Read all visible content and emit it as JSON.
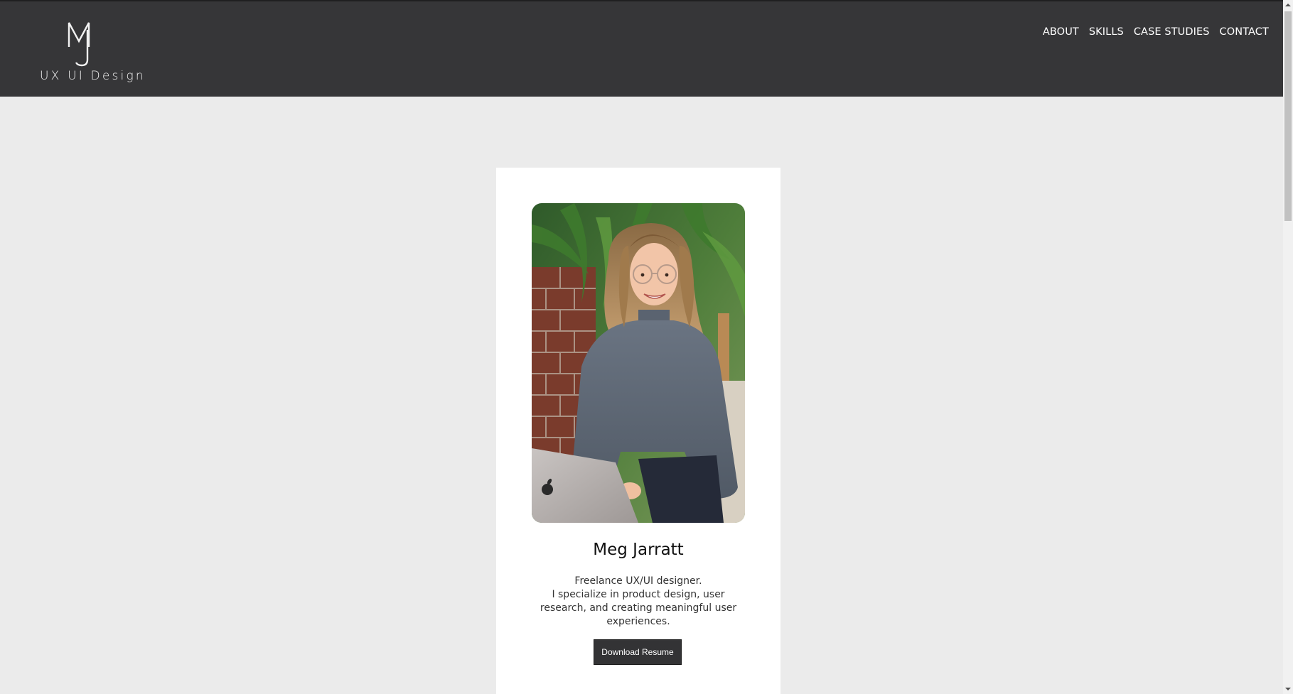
{
  "header": {
    "logo_monogram": "MJ",
    "logo_text": "UX UI Design",
    "nav": [
      {
        "label": "ABOUT"
      },
      {
        "label": "SKILLS"
      },
      {
        "label": "CASE STUDIES"
      },
      {
        "label": "CONTACT"
      }
    ]
  },
  "profile": {
    "name": "Meg Jarratt",
    "bio_lines": [
      "Freelance UX/UI designer.",
      "I specialize in product design, user",
      "research, and creating meaningful user",
      "experiences."
    ],
    "button_label": "Download Resume",
    "photo_alt": "Portrait of Meg Jarratt smiling with a laptop"
  },
  "colors": {
    "header_bg": "#363638",
    "page_bg": "#ebebeb",
    "card_bg": "#ffffff",
    "button_bg": "#333335"
  }
}
